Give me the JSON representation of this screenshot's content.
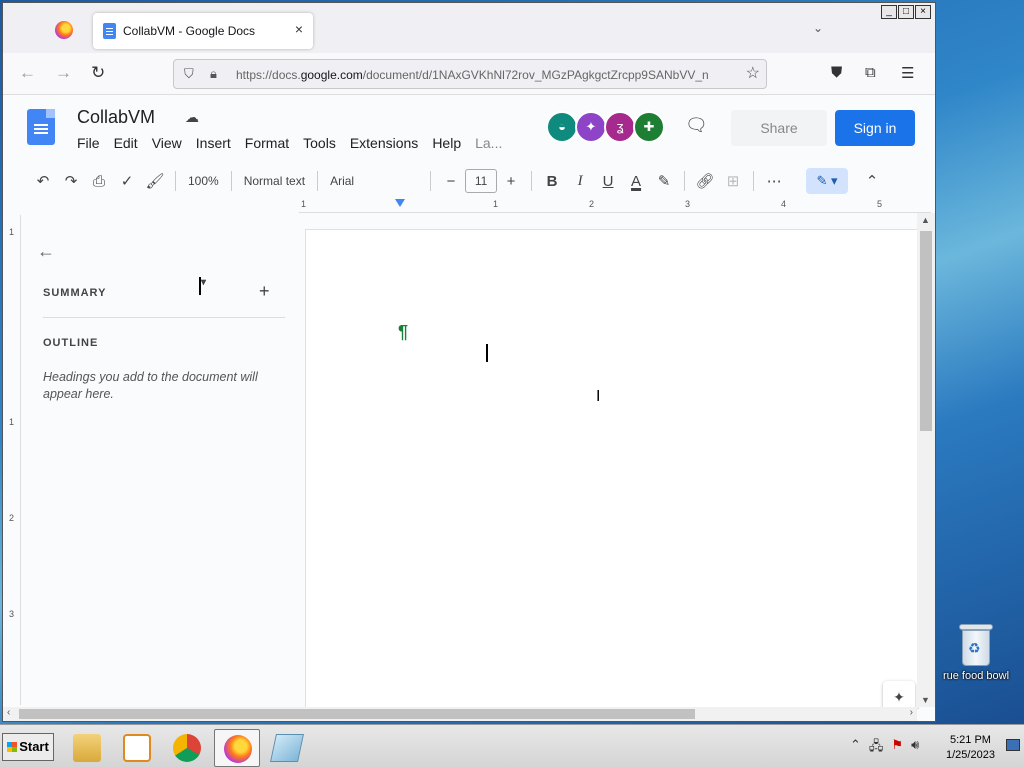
{
  "window_controls": [
    "_",
    "□",
    "×"
  ],
  "browser": {
    "tab": {
      "title": "CollabVM - Google Docs",
      "close": "×"
    },
    "tab_list": "⌄",
    "url_domain_prefix": "https://docs.",
    "url_domain": "google.com",
    "url_path": "/document/d/1NAxGVKhNl72rov_MGzPAgkgctZrcpp9SANbVV_n",
    "nav": {
      "back": "←",
      "forward": "→",
      "reload": "↻"
    },
    "icons": [
      "pocket-icon",
      "extensions-icon",
      "menu-icon"
    ]
  },
  "docs": {
    "title": "CollabVM",
    "menu": [
      "File",
      "Edit",
      "View",
      "Insert",
      "Format",
      "Tools",
      "Extensions",
      "Help",
      "La..."
    ],
    "share_label": "Share",
    "signin_label": "Sign in",
    "avatars": [
      {
        "color": "#0f8a7e",
        "glyph": "◒"
      },
      {
        "color": "#8e44c7",
        "glyph": "✦"
      },
      {
        "color": "#a62a8e",
        "glyph": "ʓ"
      },
      {
        "color": "#1e7e34",
        "glyph": "✚"
      }
    ],
    "toolbar": {
      "zoom": "100%",
      "style": "Normal text",
      "font": "Arial",
      "font_size": "11",
      "minus": "−",
      "plus": "+"
    },
    "ruler_marks": [
      "1",
      "1",
      "2",
      "3",
      "4",
      "5"
    ],
    "vruler_marks": [
      "1",
      "1",
      "2",
      "3"
    ],
    "outline": {
      "summary_label": "SUMMARY",
      "outline_label": "OUTLINE",
      "hint": "Headings you add to the document will appear here."
    },
    "page": {
      "paragraph_mark": "¶"
    }
  },
  "desktop": {
    "icon_label": "rue food bowl"
  },
  "taskbar": {
    "start_label": "Start",
    "clock_time": "5:21 PM",
    "clock_date": "1/25/2023"
  }
}
